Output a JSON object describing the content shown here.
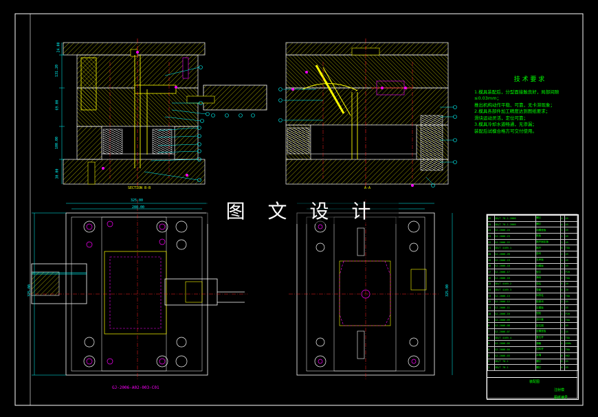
{
  "watermark": "图 文 设 计",
  "technical_requirements": {
    "title": "技 术 要 求",
    "lines": [
      "1.模具装配后，分型面接触良好，局部间隙≤0.03mm；",
      "  推出机构动作平稳、可靠，无卡滞现象；",
      "2.模具各部件加工精度达到图纸要求；",
      "  滑块运动灵活，定位可靠；",
      "3.模具冷却水道畅通，无渗漏；",
      "  装配后试模合格方可交付使用。"
    ]
  },
  "section_captions": {
    "left": "SECTION B-B",
    "right": "A-A"
  },
  "part_number": "GJ-2006-A02-003-C01",
  "dimensions": {
    "top_width": "325.00",
    "inner_width": "280.00",
    "height": "325.00",
    "h1": "24.00",
    "h2": "131.20",
    "h3": "69.00",
    "h4": "100.00",
    "h5": "30.00"
  },
  "bom": {
    "rows": [
      [
        "26",
        "GB/T 70.1-2000",
        "螺钉",
        "4",
        "45"
      ],
      [
        "25",
        "GB/T 70.1-2000",
        "螺钉",
        "4",
        "45"
      ],
      [
        "24",
        "GJ-2006-24",
        "动模座板",
        "1",
        "45"
      ],
      [
        "23",
        "GJ-2006-23",
        "推板",
        "1",
        "45"
      ],
      [
        "22",
        "GJ-2006-22",
        "推杆固定板",
        "1",
        "45"
      ],
      [
        "21",
        "GB/T 4169.1",
        "推杆",
        "8",
        "T8A"
      ],
      [
        "20",
        "GJ-2006-20",
        "垫块",
        "2",
        "45"
      ],
      [
        "19",
        "GJ-2006-19",
        "支承板",
        "1",
        "45"
      ],
      [
        "18",
        "GJ-2006-18",
        "动模板",
        "1",
        "45"
      ],
      [
        "17",
        "GJ-2006-17",
        "型芯",
        "1",
        "P20"
      ],
      [
        "16",
        "GJ-2006-16",
        "滑块",
        "2",
        "T8A"
      ],
      [
        "15",
        "GB/T 4169.2",
        "导柱",
        "4",
        "20"
      ],
      [
        "14",
        "GB/T 4169.3",
        "导套",
        "4",
        "20"
      ],
      [
        "13",
        "GJ-2006-13",
        "斜导柱",
        "2",
        "T8A"
      ],
      [
        "12",
        "GJ-2006-12",
        "楔紧块",
        "2",
        "45"
      ],
      [
        "11",
        "GJ-2006-11",
        "定模板",
        "1",
        "45"
      ],
      [
        "10",
        "GJ-2006-10",
        "型腔",
        "1",
        "P20"
      ],
      [
        "9",
        "GJ-2006-09",
        "浇口套",
        "1",
        "T8A"
      ],
      [
        "8",
        "GJ-2006-08",
        "定位圈",
        "1",
        "45"
      ],
      [
        "7",
        "GJ-2006-07",
        "定模座板",
        "1",
        "45"
      ],
      [
        "6",
        "GB/T 4169.4",
        "复位杆",
        "4",
        "T8A"
      ],
      [
        "5",
        "GJ-2006-05",
        "弹簧",
        "4",
        "65Mn"
      ],
      [
        "4",
        "GJ-2006-04",
        "拉料杆",
        "1",
        "T8A"
      ],
      [
        "3",
        "GJ-2006-03",
        "水嘴",
        "8",
        "H62"
      ],
      [
        "2",
        "GB/T 70.1",
        "螺钉",
        "6",
        "45"
      ],
      [
        "1",
        "GB/T 70.1",
        "螺钉",
        "6",
        "45"
      ]
    ]
  },
  "title_block": {
    "name": "装配图",
    "drawing_title": "注射模",
    "school": "图纸编号"
  },
  "colors": {
    "outline": "#ffffff",
    "hatch": "#ffff00",
    "center": "#ff2020",
    "dim": "#00ffff",
    "part": "#ff00ff",
    "leader": "#00ffff",
    "spring": "#ffffff",
    "green": "#00ff00"
  }
}
